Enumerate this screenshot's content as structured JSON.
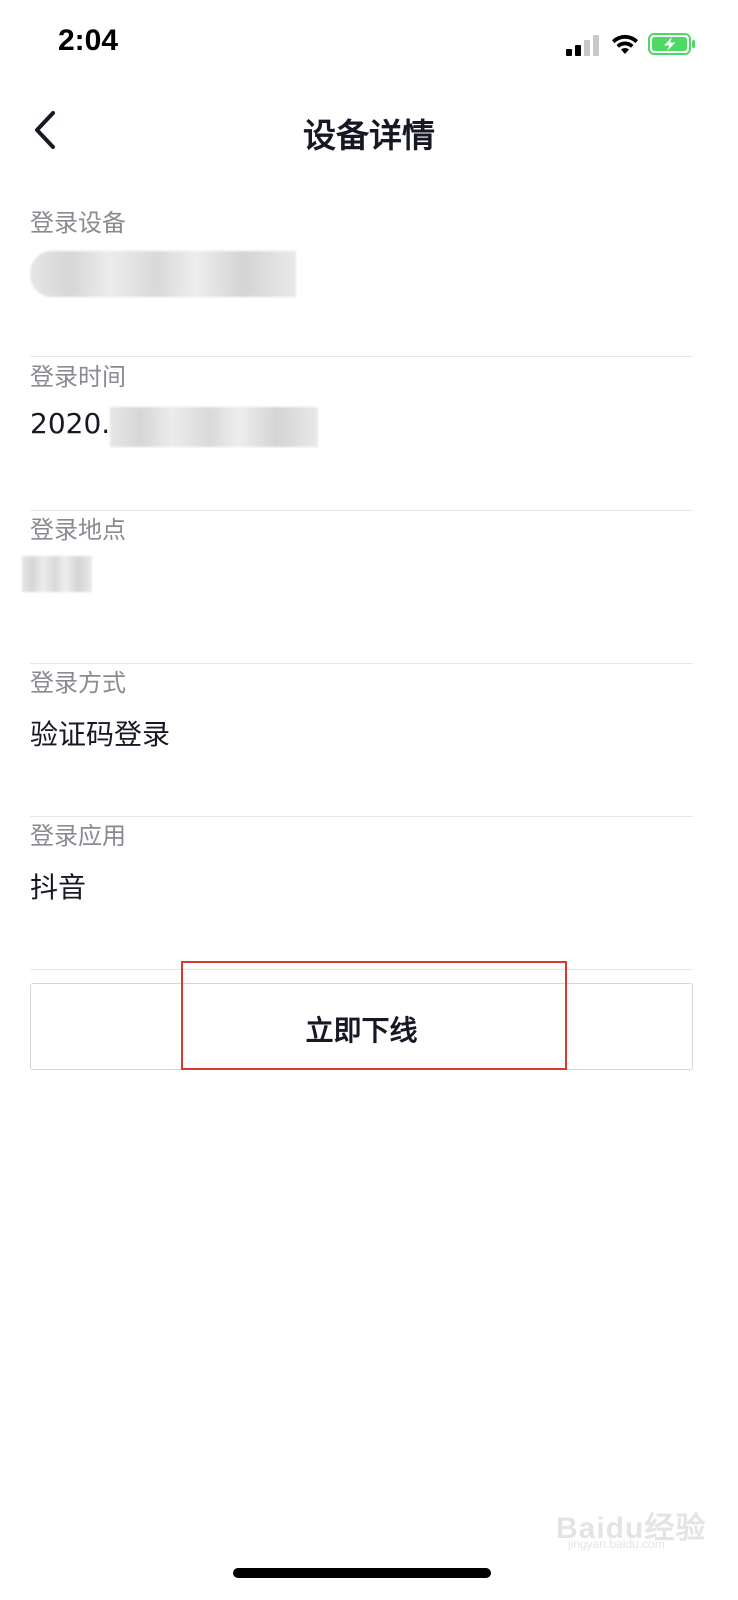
{
  "status_bar": {
    "time": "2:04"
  },
  "nav": {
    "title": "设备详情"
  },
  "sections": [
    {
      "label": "登录设备",
      "value": ""
    },
    {
      "label": "登录时间",
      "value": "2020."
    },
    {
      "label": "登录地点",
      "value": ""
    },
    {
      "label": "登录方式",
      "value": "验证码登录"
    },
    {
      "label": "登录应用",
      "value": "抖音"
    }
  ],
  "action": {
    "offline_label": "立即下线"
  },
  "watermark": {
    "brand": "Baidu经验",
    "url": "jingyan.baidu.com"
  },
  "colors": {
    "highlight": "#d9382c",
    "battery": "#4cd964",
    "text_primary": "#161823",
    "text_secondary": "#8a8b91"
  },
  "icons": {
    "back": "chevron-left-icon",
    "signal": "cellular-signal-icon",
    "wifi": "wifi-icon",
    "battery": "battery-charging-icon"
  }
}
